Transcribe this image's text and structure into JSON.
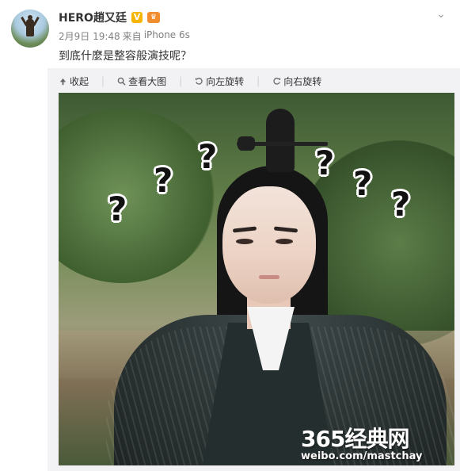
{
  "post": {
    "username": "HERO趙又廷",
    "badge_v": "V",
    "badge_crown": "♛",
    "date": "2月9日 19:48",
    "source_prefix": "来自",
    "source": "iPhone 6s",
    "content": "到底什麼是整容般演技呢？"
  },
  "toolbar": {
    "collect": "收起",
    "view_large": "查看大图",
    "rotate_left": "向左旋转",
    "rotate_right": "向右旋转"
  },
  "photo": {
    "question_marks": [
      "?",
      "?",
      "?",
      "?",
      "?",
      "?"
    ]
  },
  "watermark": {
    "line1": "365经典网",
    "line2": "weibo.com/mastchay"
  },
  "colors": {
    "accent": "#f7b500",
    "meta_text": "#808080",
    "panel_bg": "#f2f2f5"
  },
  "icons": {
    "collect": "collapse-arrow-icon",
    "view_large": "magnifier-icon",
    "rotate_left": "rotate-left-icon",
    "rotate_right": "rotate-right-icon",
    "menu": "chevron-down-icon"
  }
}
